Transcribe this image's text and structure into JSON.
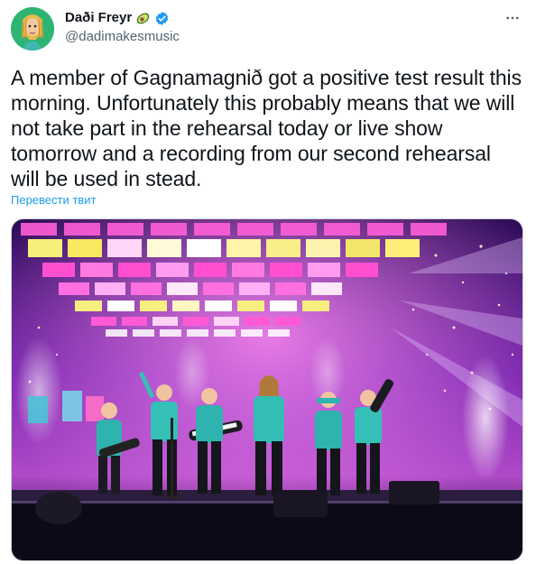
{
  "tweet": {
    "display_name": "Daði Freyr",
    "handle": "@dadimakesmusic",
    "text": "A member of Gagnamagnið got a positive test result this morning. Unfortunately this probably means that we will not take part in the rehearsal today or live show tomorrow and a recording from our second rehearsal will be used in stead.",
    "translate_label": "Перевести твит"
  },
  "icons": {
    "more": "more-horizontal-icon",
    "verified": "verified-badge-icon",
    "emoji": "avocado-emoji-icon"
  },
  "colors": {
    "link": "#1d9bf0",
    "verified": "#1d9bf0",
    "avatar_bg": "#2fb573",
    "secondary_text": "#536471"
  }
}
